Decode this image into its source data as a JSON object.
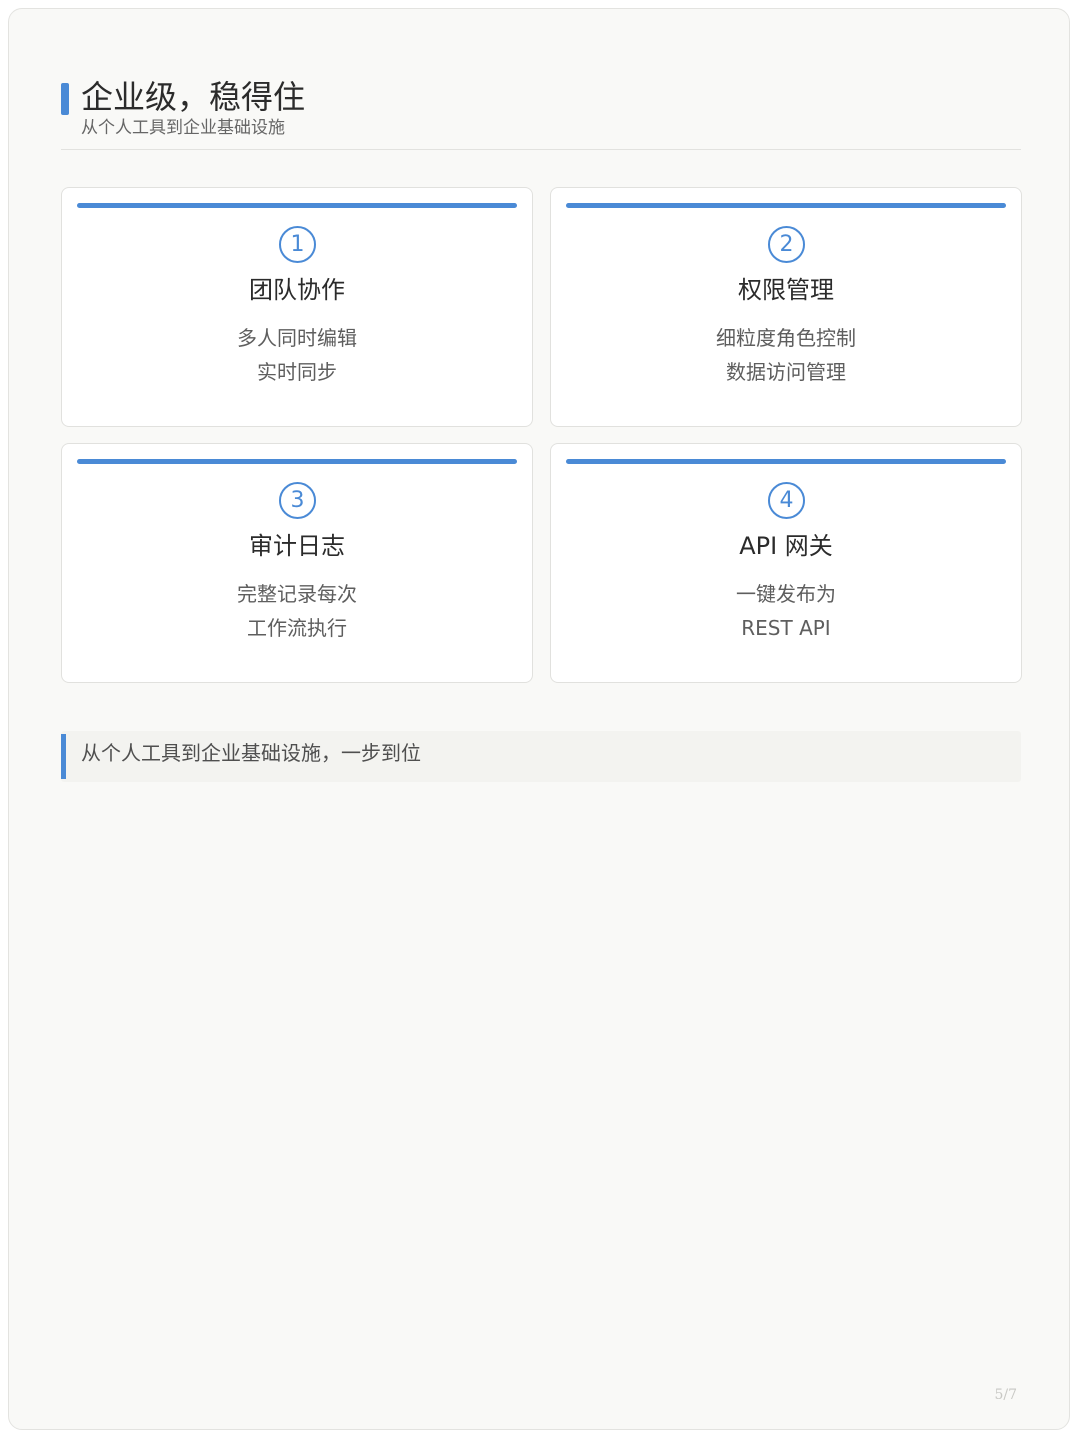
{
  "header": {
    "title": "企业级，稳得住",
    "subtitle": "从个人工具到企业基础设施"
  },
  "cards": [
    {
      "number": "1",
      "title": "团队协作",
      "line1": "多人同时编辑",
      "line2": "实时同步"
    },
    {
      "number": "2",
      "title": "权限管理",
      "line1": "细粒度角色控制",
      "line2": "数据访问管理"
    },
    {
      "number": "3",
      "title": "审计日志",
      "line1": "完整记录每次",
      "line2": "工作流执行"
    },
    {
      "number": "4",
      "title": "API 网关",
      "line1": "一键发布为",
      "line2": "REST API"
    }
  ],
  "callout": {
    "text": "从个人工具到企业基础设施，一步到位"
  },
  "footer": {
    "page_number": "5/7"
  },
  "colors": {
    "accent": "#4a8ad6",
    "background": "#f9f9f7",
    "card": "#ffffff"
  }
}
